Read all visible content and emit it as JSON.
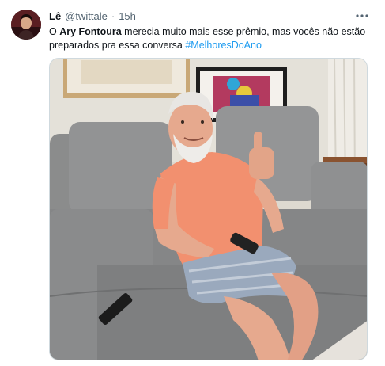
{
  "tweet": {
    "author_name": "Lê",
    "author_handle": "@twittale",
    "separator": "·",
    "time": "15h",
    "more_icon": "more-horizontal-icon",
    "text_before": "O ",
    "text_bold": "Ary Fontoura",
    "text_after": " merecia muito mais esse prêmio, mas vocês não estão preparados pra essa conversa ",
    "hashtag": "#MelhoresDoAno",
    "hashtag_color": "#1d9bf0"
  },
  "colors": {
    "name": "#0f1419",
    "secondary": "#536471",
    "media_border": "#cfd9de"
  }
}
